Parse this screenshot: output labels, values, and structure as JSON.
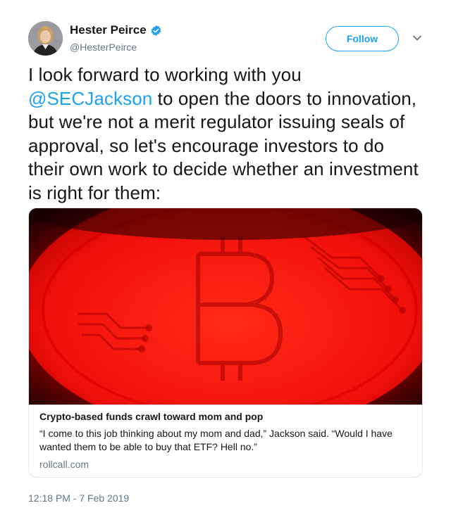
{
  "author": {
    "display_name": "Hester Peirce",
    "handle": "@HesterPeirce",
    "verified": true
  },
  "follow_button": {
    "label": "Follow"
  },
  "tweet": {
    "text_before": "I look forward to working with you ",
    "mention": "@SECJackson",
    "text_after": " to open the doors to innovation, but we're not a merit regulator issuing seals of approval, so let's encourage investors to do their own work to decide whether an investment is right for them:",
    "timestamp": "12:18 PM - 7 Feb 2019"
  },
  "link_card": {
    "title": "Crypto-based funds crawl toward mom and pop",
    "description": "“I come to this job thinking about my mom and dad,” Jackson said. “Would I have wanted them to be able to buy that ETF? Hell no.”",
    "domain": "rollcall.com"
  },
  "colors": {
    "accent": "#1da1f2",
    "text": "#14171a",
    "secondary_text": "#657786",
    "border": "#e1e8ed",
    "image_red": "#ff1a10"
  },
  "icons": [
    "verified-badge-icon",
    "chevron-down-icon",
    "bitcoin-coin-image"
  ]
}
